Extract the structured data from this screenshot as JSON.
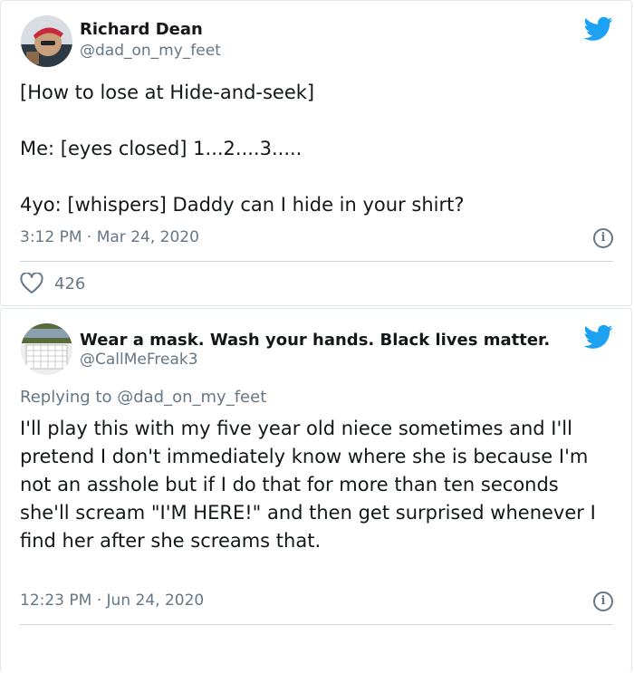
{
  "tweets": [
    {
      "author_name": "Richard Dean",
      "author_handle": "@dad_on_my_feet",
      "text": "[How to lose at Hide-and-seek]\n\nMe: [eyes closed] 1...2....3.....\n\n4yo: [whispers] Daddy can I hide in your shirt?",
      "time": "3:12 PM",
      "separator": "·",
      "date": "Mar 24, 2020",
      "like_count": "426",
      "icons": {
        "bird": "twitter-bird-icon",
        "info": "info-icon",
        "like": "heart-icon"
      }
    },
    {
      "author_name": "Wear a mask. Wash your hands. Black lives matter.",
      "author_handle": "@CallMeFreak3",
      "replying_prefix": "Replying to",
      "replying_to": "@dad_on_my_feet",
      "text": "I'll play this with my five year old niece sometimes and I'll pretend I don't immediately know where she is because I'm not an asshole but if I do that for more than ten seconds she'll scream \"I'M HERE!\" and then get surprised whenever I find her after she screams that.",
      "time": "12:23 PM",
      "separator": "·",
      "date": "Jun 24, 2020",
      "icons": {
        "bird": "twitter-bird-icon",
        "info": "info-icon"
      }
    }
  ],
  "colors": {
    "brand_blue": "#1da1f2",
    "text_primary": "#14171a",
    "text_secondary": "#657786",
    "border": "#e1e8ed"
  }
}
